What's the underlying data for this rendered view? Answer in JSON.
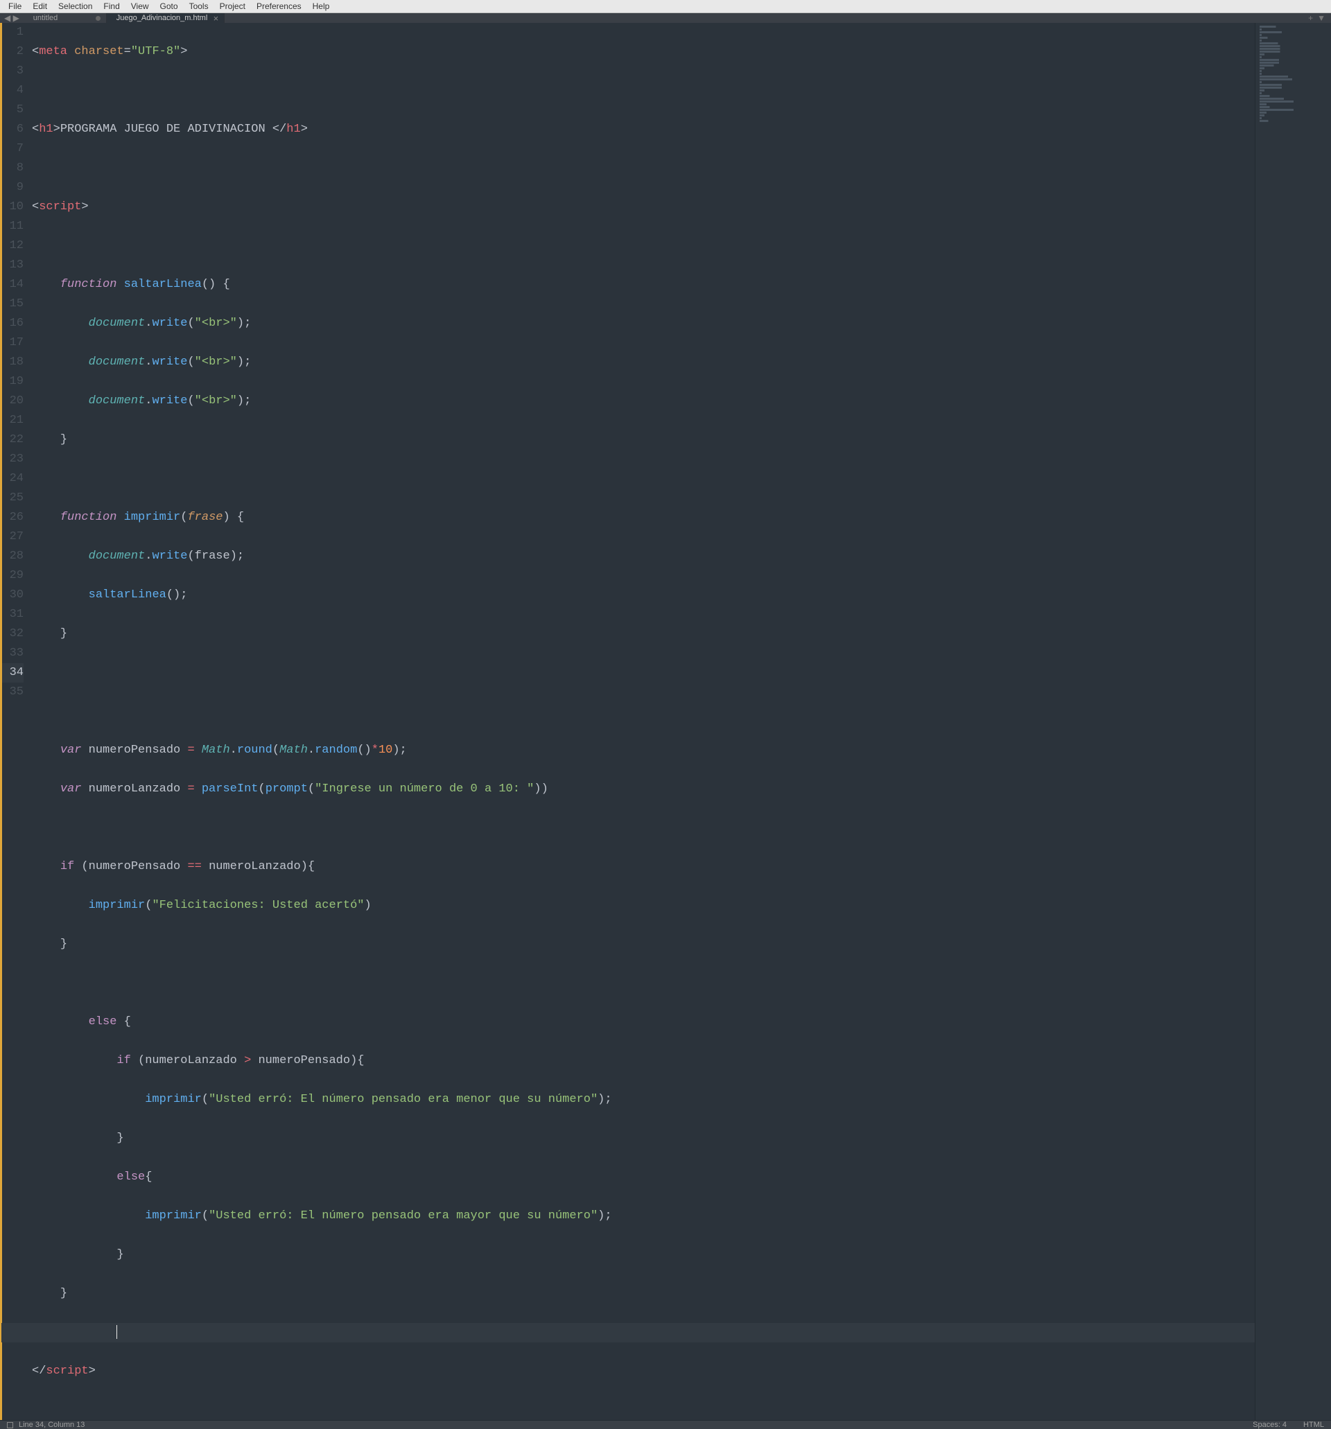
{
  "menu": [
    "File",
    "Edit",
    "Selection",
    "Find",
    "View",
    "Goto",
    "Tools",
    "Project",
    "Preferences",
    "Help"
  ],
  "tabs": [
    {
      "label": "untitled",
      "active": false,
      "dirty": true
    },
    {
      "label": "Juego_Adivinacion_m.html",
      "active": true,
      "dirty": false
    }
  ],
  "status": {
    "position": "Line 34, Column 13",
    "spaces": "Spaces: 4",
    "syntax": "HTML"
  },
  "code": {
    "t_meta": "meta",
    "a_charset": "charset",
    "v_utf8": "\"UTF-8\"",
    "t_h1": "h1",
    "txt_h1": "PROGRAMA JUEGO DE ADIVINACION ",
    "t_script": "script",
    "kw_function": "function",
    "kw_var": "var",
    "kw_if": "if",
    "kw_else": "else",
    "fn_saltar": "saltarLinea",
    "fn_imprimir": "imprimir",
    "obj_document": "document",
    "obj_math": "Math",
    "m_write": "write",
    "m_round": "round",
    "m_random": "random",
    "fn_parseInt": "parseInt",
    "fn_prompt": "prompt",
    "p_frase": "frase",
    "v_numPensado": "numeroPensado",
    "v_numLanzado": "numeroLanzado",
    "n_10": "10",
    "s_br": "\"<br>\"",
    "s_prompt": "\"Ingrese un número de 0 a 10: \"",
    "s_win": "\"Felicitaciones: Usted acertó\"",
    "s_lose_menor": "\"Usted erró: El número pensado era menor que su número\"",
    "s_lose_mayor": "\"Usted erró: El número pensado era mayor que su número\""
  }
}
